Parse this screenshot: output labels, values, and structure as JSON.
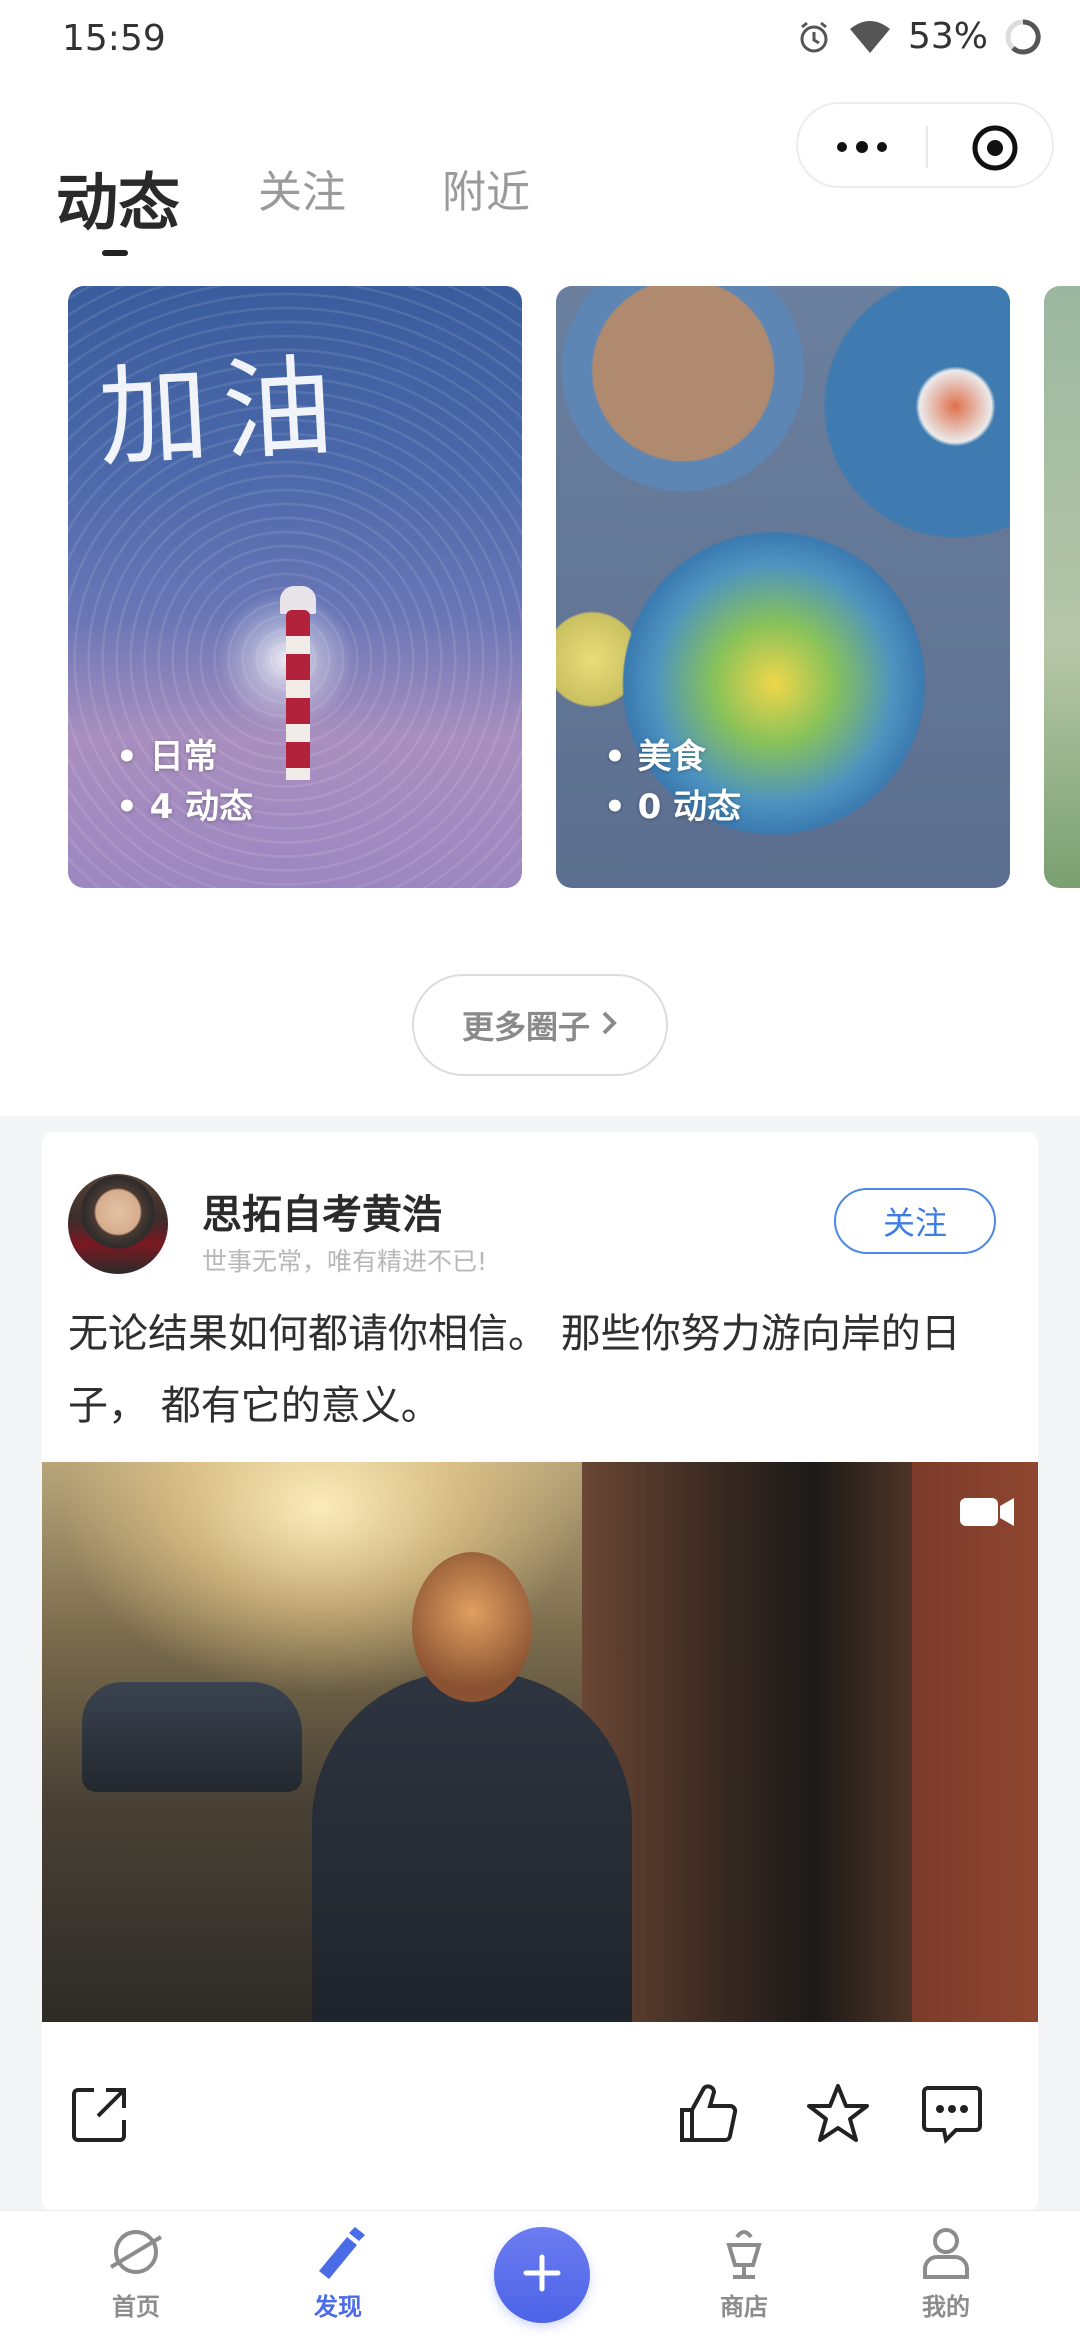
{
  "status_bar": {
    "time": "15:59",
    "battery": "53%"
  },
  "header": {
    "tabs": [
      {
        "label": "动态",
        "active": true
      },
      {
        "label": "关注",
        "active": false
      },
      {
        "label": "附近",
        "active": false
      }
    ]
  },
  "circles": [
    {
      "tag": "日常",
      "count": "4 动态",
      "image_text": "加油"
    },
    {
      "tag": "美食",
      "count": "0 动态"
    }
  ],
  "more_button": "更多圈子",
  "post": {
    "author": "思拓自考黄浩",
    "motto": "世事无常，唯有精进不已!",
    "follow_label": "关注",
    "content": "无论结果如何都请你相信。 那些你努力游向岸的日子， 都有它的意义。"
  },
  "bottom_nav": [
    {
      "label": "首页",
      "icon": "planet-icon"
    },
    {
      "label": "发现",
      "icon": "pen-icon"
    },
    {
      "label": "",
      "icon": "plus-icon"
    },
    {
      "label": "商店",
      "icon": "cup-icon"
    },
    {
      "label": "我的",
      "icon": "user-icon"
    }
  ],
  "colors": {
    "accent": "#4d64e8",
    "follow_blue": "#3f7de6"
  }
}
